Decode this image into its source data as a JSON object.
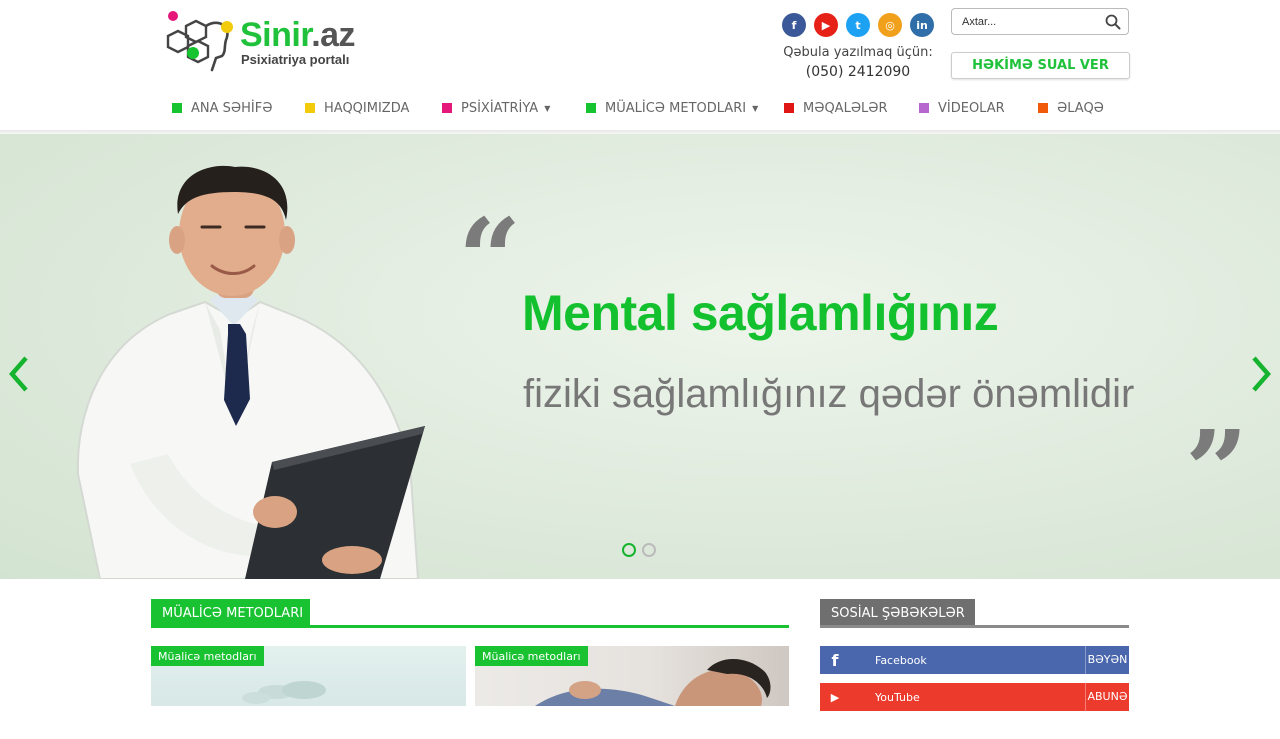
{
  "brand": {
    "name_main": "Sinir",
    "name_suffix": ".az",
    "tagline": "Psixiatriya portalı"
  },
  "socials": [
    {
      "name": "facebook",
      "glyph": "f",
      "color": "#3b5998"
    },
    {
      "name": "youtube",
      "glyph": "▶",
      "color": "#e62117"
    },
    {
      "name": "twitter",
      "glyph": "t",
      "color": "#1da1f2"
    },
    {
      "name": "instagram",
      "glyph": "◎",
      "color": "#f0a01a"
    },
    {
      "name": "linkedin",
      "glyph": "in",
      "color": "#2f6ea8"
    }
  ],
  "contact": {
    "label": "Qəbula yazılmaq üçün:",
    "phone": "(050) 2412090"
  },
  "search": {
    "placeholder": "Axtar..."
  },
  "ask_button": "HƏKİMƏ SUAL VER",
  "nav": [
    {
      "label": "ANA SƏHİFƏ",
      "color": "#16c42f",
      "dropdown": false
    },
    {
      "label": "HAQQIMIZDA",
      "color": "#f2cc0c",
      "dropdown": false
    },
    {
      "label": "PSİXİATRİYA",
      "color": "#e5177b",
      "dropdown": true
    },
    {
      "label": "MÜALİCƏ METODLARI",
      "color": "#16c42f",
      "dropdown": true
    },
    {
      "label": "MƏQALƏLƏR",
      "color": "#e01515",
      "dropdown": false
    },
    {
      "label": "VİDEOLAR",
      "color": "#b766cf",
      "dropdown": false
    },
    {
      "label": "ƏLAQƏ",
      "color": "#f05a0a",
      "dropdown": false
    }
  ],
  "hero": {
    "heading": "Mental sağlamlığınız",
    "subheading": "fiziki sağlamlığınız qədər önəmlidir",
    "quote_open": "“",
    "quote_close": "”",
    "slides": 2,
    "active_slide": 1
  },
  "sections": {
    "treatment": {
      "title": "MÜALİCƏ METODLARI",
      "cards": [
        {
          "tag": "Müalicə metodları"
        },
        {
          "tag": "Müalicə metodları"
        }
      ]
    },
    "social": {
      "title": "SOSİAL ŞƏBƏKƏLƏR",
      "rows": [
        {
          "name": "Facebook",
          "action": "BƏYƏN",
          "icon": "f",
          "color": "#4a67ad"
        },
        {
          "name": "YouTube",
          "action": "ABUNƏ OL",
          "icon": "▶",
          "color": "#ec3a2d"
        }
      ]
    }
  },
  "colors": {
    "brand_green": "#1fc23a",
    "section_dark": "#6f6f6f"
  }
}
